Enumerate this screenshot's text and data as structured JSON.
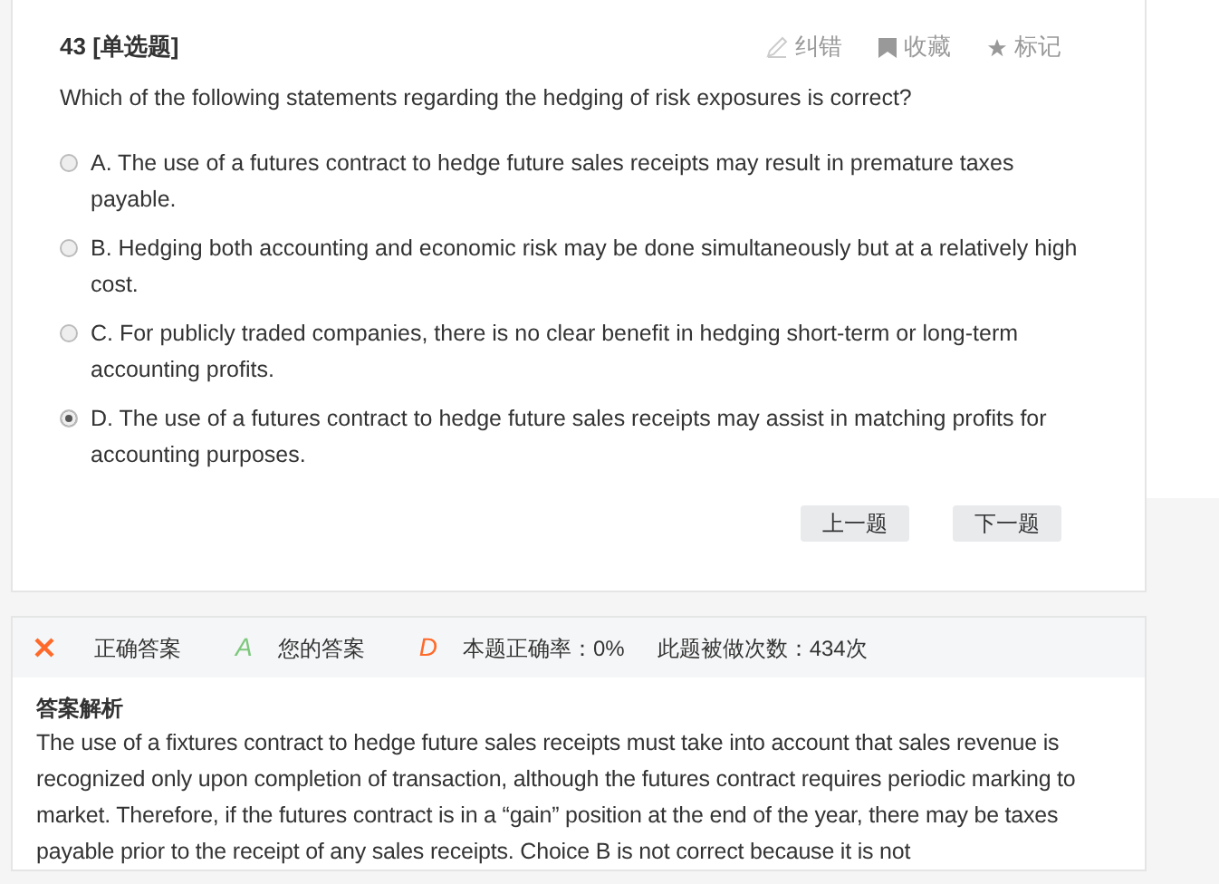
{
  "question": {
    "number": "43",
    "type": "[单选题]",
    "actions": [
      {
        "kind": "correct",
        "label": "纠错"
      },
      {
        "kind": "favorite",
        "label": "收藏"
      },
      {
        "kind": "mark",
        "label": "标记"
      }
    ],
    "text": "Which of the following statements regarding the hedging of risk exposures is correct?",
    "options": [
      {
        "text": "A. The use of a futures contract to hedge future sales receipts may result in premature taxes payable.",
        "selected": false
      },
      {
        "text": "B. Hedging both accounting and economic risk may be done simultaneously but at a relatively high cost.",
        "selected": false
      },
      {
        "text": "C. For publicly traded companies, there is no clear benefit in hedging short-term or long-term accounting profits.",
        "selected": false
      },
      {
        "text": "D. The use of a futures contract to hedge future sales receipts may assist in matching profits for accounting purposes.",
        "selected": true
      }
    ],
    "buttons": [
      "上一题",
      "下一题"
    ]
  },
  "result": {
    "correct_answer": "A",
    "correct_label": "正确答案",
    "your_answer": "D",
    "your_label": "您的答案",
    "accuracy": "本题正确率：0%",
    "attempts": "此题被做次数：434次"
  },
  "explanation": {
    "title": "答案解析",
    "text": "The use of a fixtures contract to hedge future sales receipts must take into account that sales revenue is recognized only upon completion of transaction, although the futures contract requires periodic marking to market. Therefore, if the futures contract is in a “gain” position at the end of the year, there may be taxes payable prior to the receipt of any sales receipts. Choice B is not correct because it is not"
  }
}
